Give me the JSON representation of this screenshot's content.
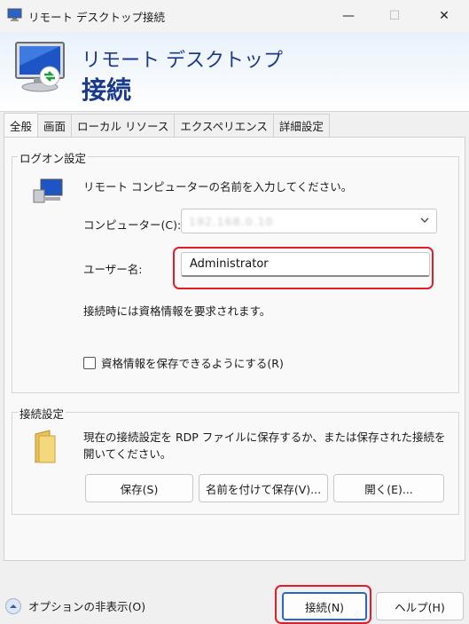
{
  "window": {
    "title": "リモート デスクトップ接続",
    "minimize": "—",
    "maximize": "☐",
    "close": "✕"
  },
  "banner": {
    "line1": "リモート デスクトップ",
    "line2": "接続"
  },
  "tabs": [
    {
      "label": "全般",
      "active": true
    },
    {
      "label": "画面"
    },
    {
      "label": "ローカル リソース"
    },
    {
      "label": "エクスペリエンス"
    },
    {
      "label": "詳細設定"
    }
  ],
  "logon": {
    "legend": "ログオン設定",
    "instruction": "リモート コンピューターの名前を入力してください。",
    "computer_label": "コンピューター(C):",
    "computer_value": "192.168.0.10",
    "user_label": "ユーザー名:",
    "user_value": "Administrator",
    "credential_note": "接続時には資格情報を要求されます。",
    "save_credentials_label": "資格情報を保存できるようにする(R)",
    "save_credentials_checked": false
  },
  "connection": {
    "legend": "接続設定",
    "description": "現在の接続設定を RDP ファイルに保存するか、または保存された接続を開いてください。",
    "save_button": "保存(S)",
    "save_as_button": "名前を付けて保存(V)...",
    "open_button": "開く(E)..."
  },
  "footer": {
    "options_label": "オプションの非表示(O)",
    "connect_button": "接続(N)",
    "help_button": "ヘルプ(H)"
  },
  "colors": {
    "banner_text": "#1b3a8c",
    "highlight": "#e11c2b",
    "default_button_border": "#2d66c2"
  }
}
